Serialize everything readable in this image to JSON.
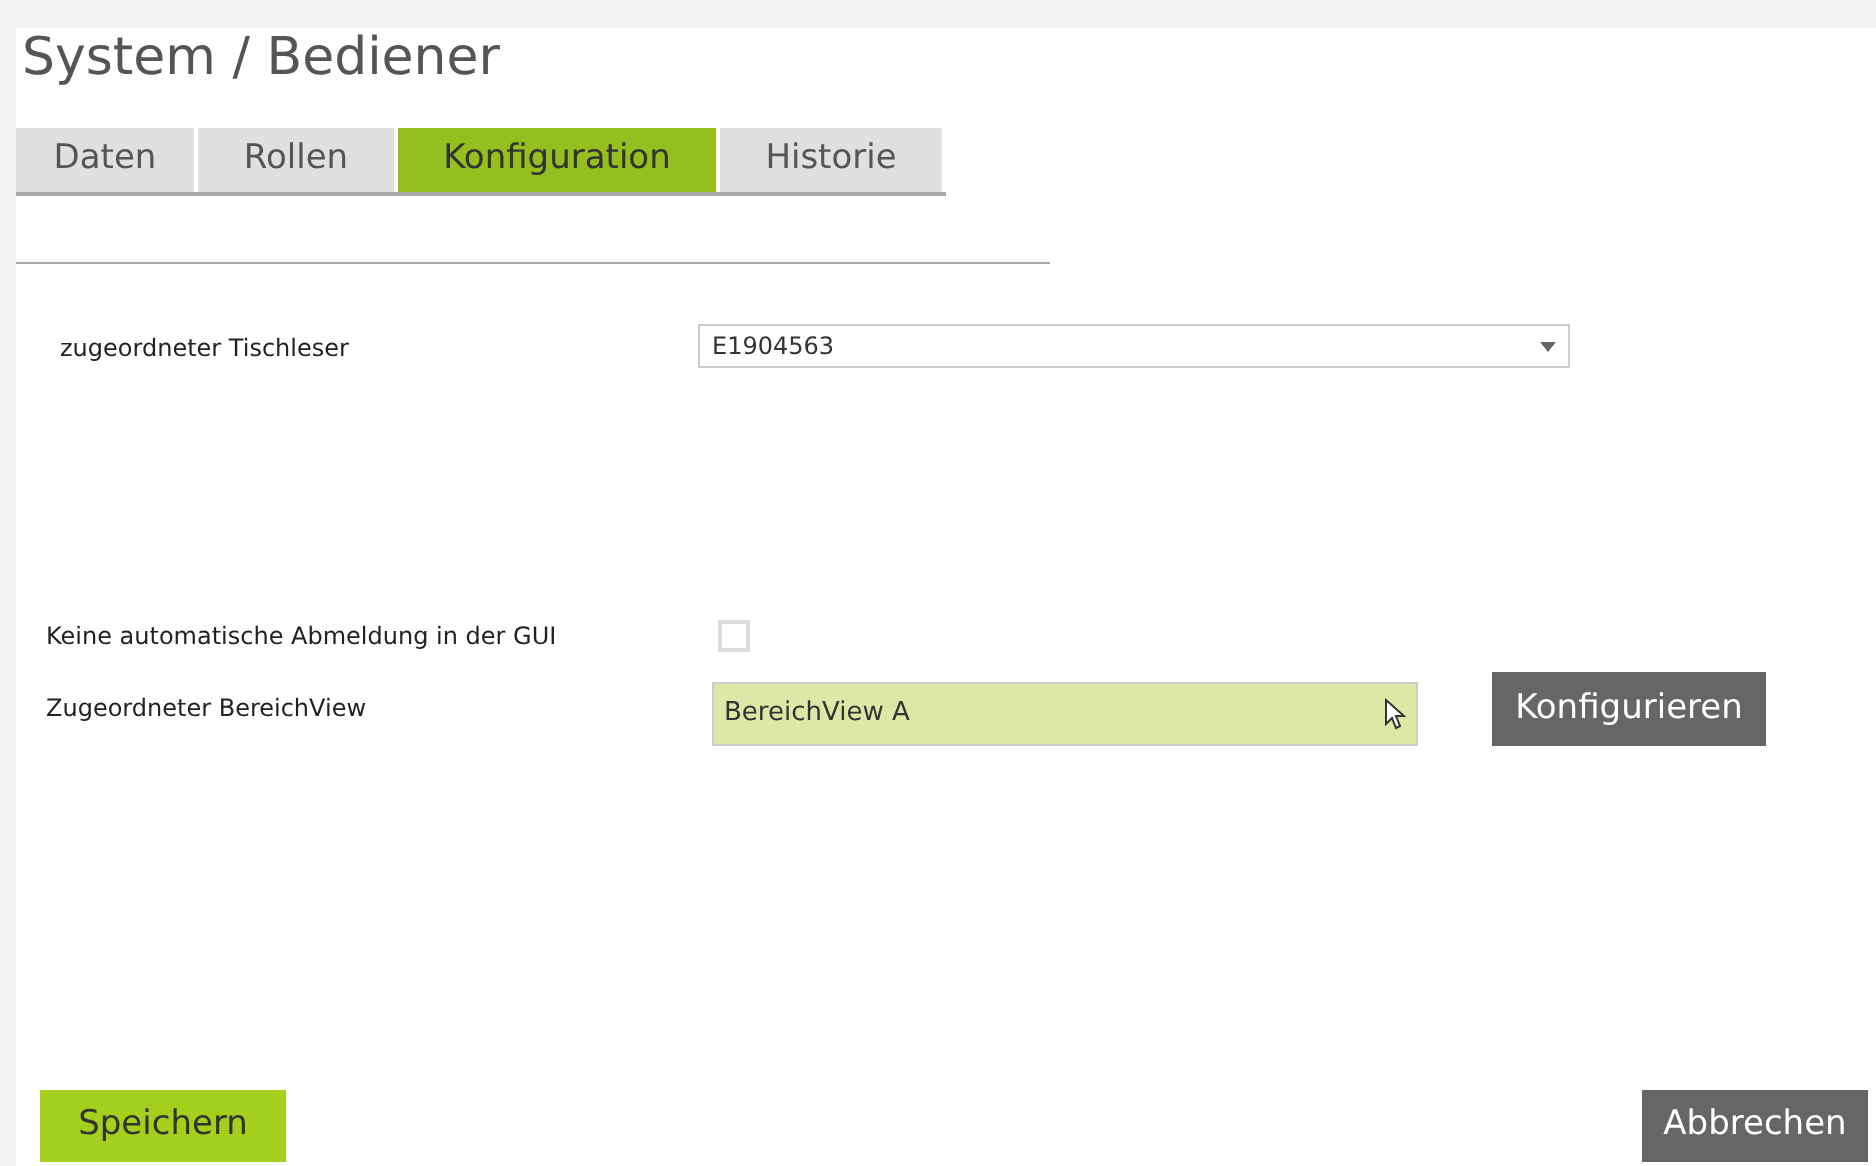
{
  "page": {
    "title": "System / Bediener"
  },
  "tabs": [
    {
      "label": "Daten",
      "selected": false
    },
    {
      "label": "Rollen",
      "selected": false
    },
    {
      "label": "Konfiguration",
      "selected": true
    },
    {
      "label": "Historie",
      "selected": false
    }
  ],
  "fields": [
    {
      "kind": "select",
      "label": "zugeordneter Tischleser",
      "value": "E1904563"
    },
    {
      "kind": "checkbox",
      "label": "Keine automatische Abmeldung in der GUI",
      "checked": false
    },
    {
      "kind": "highlighted",
      "label": "Zugeordneter BereichView",
      "value": "BereichView A",
      "button": "Konfigurieren"
    }
  ],
  "buttons": {
    "save": "Speichern",
    "cancel": "Abbrechen"
  }
}
